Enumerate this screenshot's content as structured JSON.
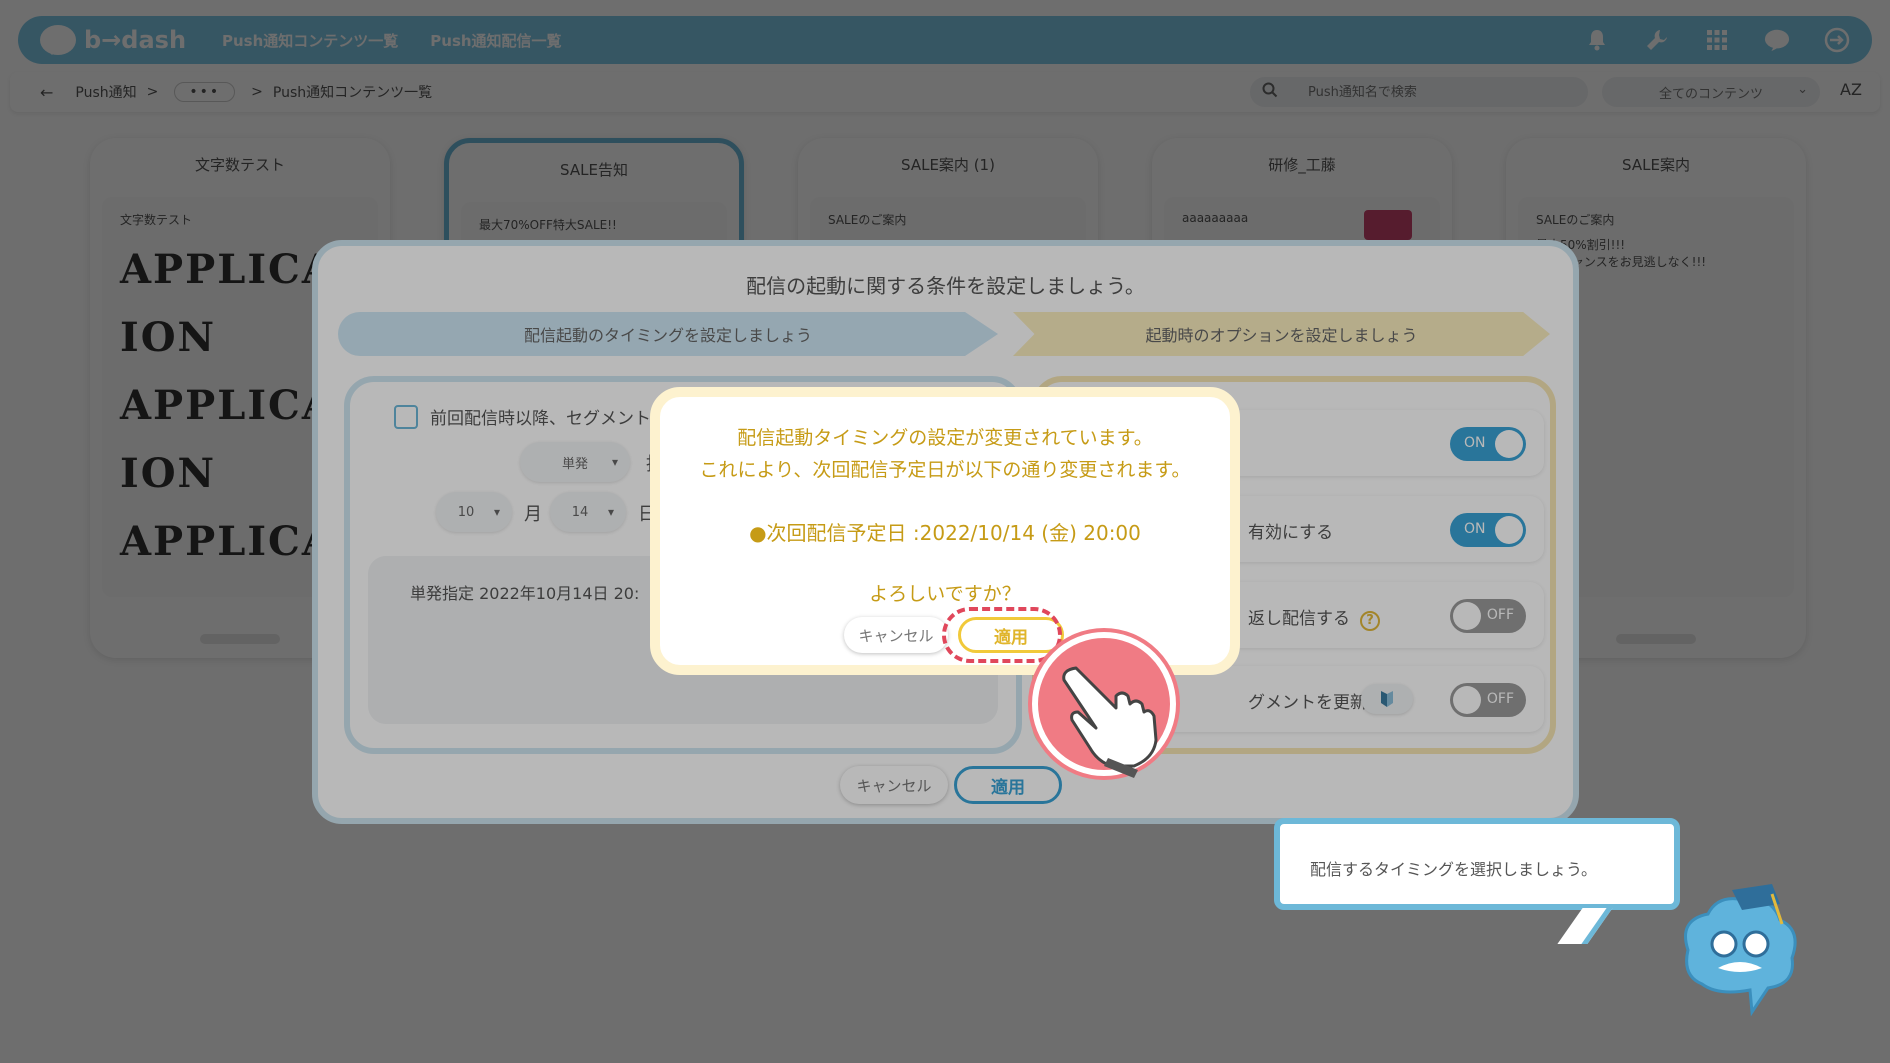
{
  "app": {
    "logo_text": "b→dash",
    "nav": [
      "Push通知コンテンツ一覧",
      "Push通知配信一覧"
    ]
  },
  "breadcrumb": {
    "root": "Push通知",
    "sep": ">",
    "more": "•••",
    "current": "Push通知コンテンツ一覧"
  },
  "search": {
    "placeholder": "Push通知名で検索"
  },
  "filter": {
    "selected": "全てのコンテンツ"
  },
  "sort_label": "AZ",
  "cards": [
    {
      "title": "文字数テスト",
      "preview_title": "文字数テスト",
      "big": [
        "APPLICA",
        "ION",
        "APPLICA",
        "ION",
        "APPLICA",
        "ION"
      ]
    },
    {
      "title": "SALE告知",
      "preview_title": "最大70%OFF特大SALE!!"
    },
    {
      "title": "SALE案内 (1)",
      "preview_title": "SALEのご案内"
    },
    {
      "title": "研修_工藤",
      "preview_title": "aaaaaaaaa"
    },
    {
      "title": "SALE案内",
      "preview_title": "SALEのご案内",
      "preview_body": "最大50%割引!!!\nこのチャンスをお見逃しなく!!!"
    }
  ],
  "wizard": {
    "title": "配信の起動に関する条件を設定しましょう。",
    "step1": "配信起動のタイミングを設定しましょう",
    "step2": "起動時のオプションを設定しましょう",
    "checkbox_label": "前回配信時以降、セグメントが",
    "type_select": "単発",
    "type_suffix": "指",
    "month_select": "10",
    "month_label": "月",
    "day_select": "14",
    "day_label": "日",
    "summary": "単発指定 2022年10月14日 20:",
    "options": [
      {
        "text": "",
        "toggle": "ON"
      },
      {
        "text": "有効にする",
        "toggle": "ON"
      },
      {
        "text": "返し配信する",
        "toggle": "OFF"
      },
      {
        "text": "グメントを更新する",
        "toggle": "OFF"
      }
    ],
    "cancel": "キャンセル",
    "apply": "適用"
  },
  "confirm": {
    "line1": "配信起動タイミングの設定が変更されています。",
    "line2": "これにより、次回配信予定日が以下の通り変更されます。",
    "next_date": "●次回配信予定日 :2022/10/14 (金) 20:00",
    "question": "よろしいですか？",
    "cancel": "キャンセル",
    "apply": "適用"
  },
  "tooltip": {
    "text": "配信するタイミングを選択しましょう。"
  },
  "colors": {
    "brand": "#7fc8e6",
    "toggle_on": "#3aa3d6",
    "confirm_text": "#c69b16",
    "highlight_ring": "#e0475b"
  }
}
